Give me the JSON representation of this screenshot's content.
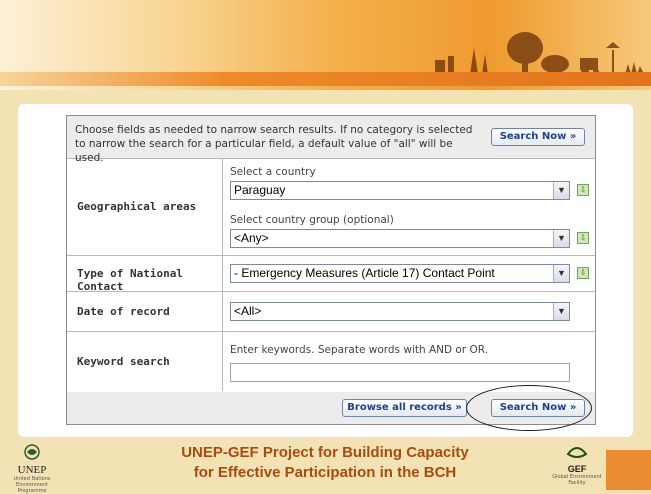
{
  "search_panel": {
    "hint": "Choose fields as needed to narrow search results. If no category is selected to narrow the search for a particular field, a default value of \"all\" will be used.",
    "search_now_label": "Search Now »"
  },
  "geographical_areas": {
    "label": "Geographical areas",
    "country_label": "Select a country",
    "country_value": "Paraguay",
    "group_label": "Select country group (optional)",
    "group_value": "<Any>"
  },
  "national_contact": {
    "label": "Type of National Contact",
    "value": "- Emergency Measures (Article 17) Contact Point"
  },
  "date_of_record": {
    "label": "Date of record",
    "value": "<All>"
  },
  "keyword_search": {
    "label": "Keyword search",
    "hint": "Enter keywords. Separate words with AND or OR.",
    "value": ""
  },
  "footer_buttons": {
    "browse_label": "Browse all records »",
    "search_label": "Search Now »"
  },
  "branding": {
    "unep_name": "UNEP",
    "unep_full": "United Nations Environment Programme",
    "project_line1": "UNEP-GEF Project for Building Capacity",
    "project_line2": "for Effective Participation in the BCH",
    "gef_name": "GEF",
    "gef_full": "Global Environment Facility"
  },
  "icons": {
    "select_arrow": "chevron-down-icon",
    "add_icon": "add-selection-icon"
  },
  "colors": {
    "banner_orange": "#ef9a2e",
    "title_orange": "#a84b0f",
    "button_text": "#1f3f8f",
    "page_background": "#f3e3b4"
  }
}
